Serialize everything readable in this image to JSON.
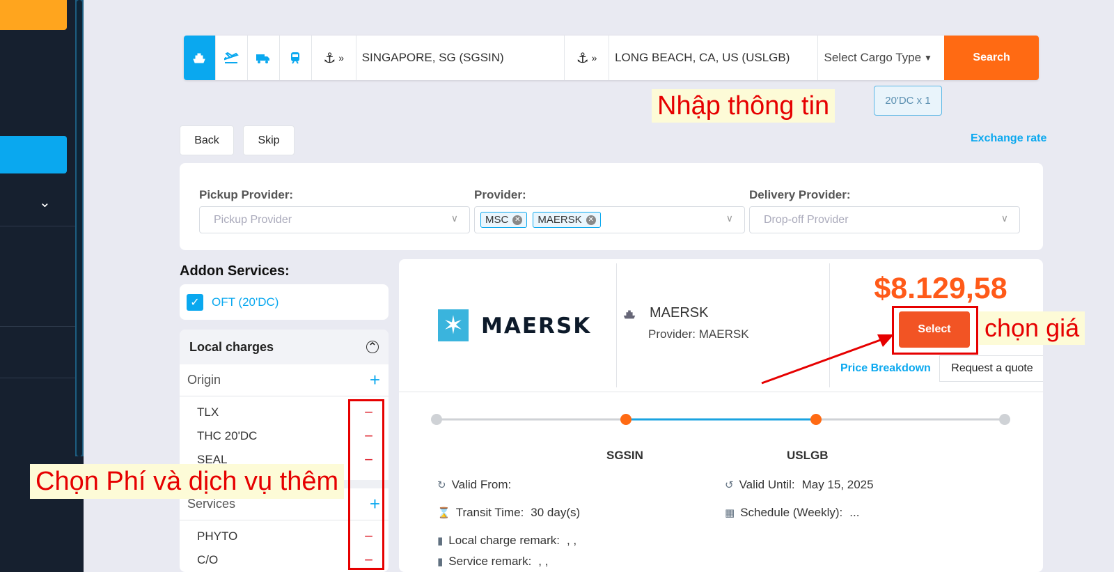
{
  "search": {
    "origin": "SINGAPORE, SG (SGSIN)",
    "destination": "LONG BEACH, CA, US (USLGB)",
    "cargo_type": "Select Cargo Type",
    "search_label": "Search",
    "cargo_chip": "20'DC x 1"
  },
  "annotations": {
    "input_info": "Nhập thông tin",
    "choose_price": "chọn giá",
    "choose_fees": "Chọn Phí và dịch vụ thêm"
  },
  "nav": {
    "back": "Back",
    "skip": "Skip",
    "exchange_rate": "Exchange rate"
  },
  "providers": {
    "pickup_label": "Pickup Provider:",
    "pickup_placeholder": "Pickup Provider",
    "provider_label": "Provider:",
    "provider_tags": [
      "MSC",
      "MAERSK"
    ],
    "delivery_label": "Delivery Provider:",
    "delivery_placeholder": "Drop-off Provider"
  },
  "addon": {
    "title": "Addon Services:",
    "item": "OFT (20'DC)"
  },
  "local_charges": {
    "title": "Local charges",
    "origin_label": "Origin",
    "origin_items": [
      "TLX",
      "THC 20'DC",
      "SEAL"
    ],
    "services_label": "Services",
    "services_items": [
      "PHYTO",
      "C/O"
    ]
  },
  "result": {
    "logo": "MAERSK",
    "carrier": "MAERSK",
    "provider": "Provider: MAERSK",
    "price": "$8.129,58",
    "select_label": "Select",
    "price_breakdown": "Price Breakdown",
    "request_quote": "Request a quote",
    "pol": "SGSIN",
    "pod": "USLGB",
    "valid_from_label": "Valid From:",
    "valid_from_value": "",
    "valid_until_label": "Valid Until:",
    "valid_until_value": "May 15, 2025",
    "transit_label": "Transit Time:",
    "transit_value": "30 day(s)",
    "schedule_label": "Schedule (Weekly):",
    "schedule_value": "...",
    "local_remark_label": "Local charge remark:",
    "local_remark_value": ", ,",
    "service_remark_label": "Service remark:",
    "service_remark_value": ", ,"
  },
  "colors": {
    "accent": "#0aa8ef",
    "search_orange": "#ff6a13",
    "price_orange": "#ff5a19",
    "annotation_red": "#e60000"
  }
}
